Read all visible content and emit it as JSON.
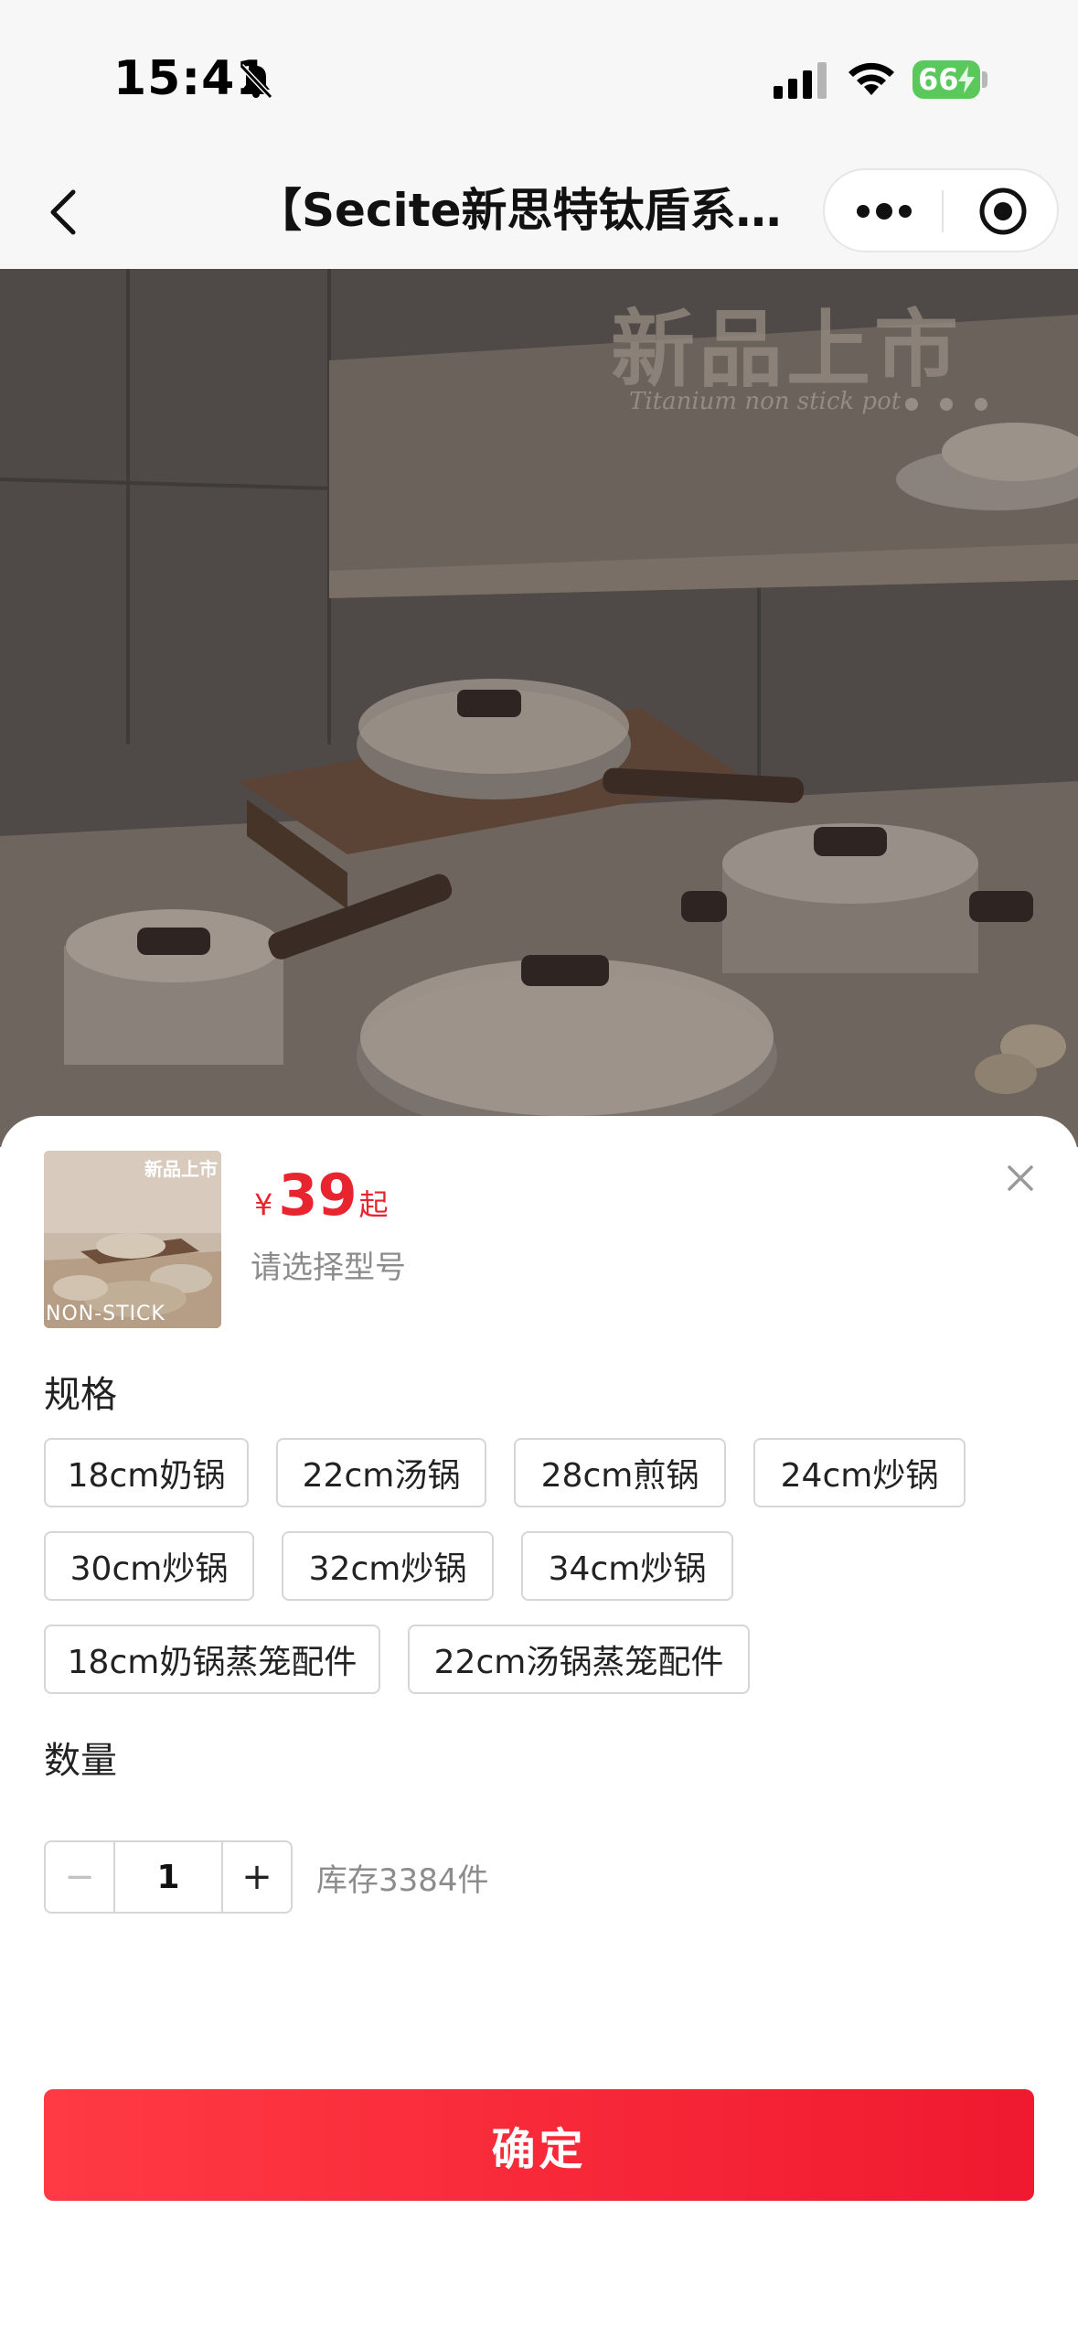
{
  "status_bar": {
    "time": "15:41",
    "battery": "66",
    "icons": [
      "bell-slash-icon",
      "cellular-signal-icon",
      "wifi-icon",
      "battery-charging-icon"
    ]
  },
  "nav": {
    "title": "【Secite新思特钛盾系列钛不粘锅】",
    "icons": [
      "chevron-left-icon",
      "more-dots-icon",
      "target-circle-icon"
    ]
  },
  "hero": {
    "headline": "新品上市",
    "subtitle": "Titanium non stick pot",
    "indicator_count": 3
  },
  "product": {
    "thumbnail_label": "新品上市",
    "thumbnail_bottom": "NON-STICK",
    "currency": "¥",
    "price": "39",
    "price_suffix": "起",
    "select_hint": "请选择型号"
  },
  "spec": {
    "label": "规格",
    "options": [
      "18cm奶锅",
      "22cm汤锅",
      "28cm煎锅",
      "24cm炒锅",
      "30cm炒锅",
      "32cm炒锅",
      "34cm炒锅",
      "18cm奶锅蒸笼配件",
      "22cm汤锅蒸笼配件"
    ]
  },
  "quantity": {
    "label": "数量",
    "minus": "−",
    "value": "1",
    "plus": "+",
    "stock": "库存3384件"
  },
  "confirm_label": "确定",
  "colors": {
    "accent": "#e8242f",
    "button_start": "#ff3a44",
    "button_end": "#f0192f",
    "battery": "#5ac85a"
  }
}
